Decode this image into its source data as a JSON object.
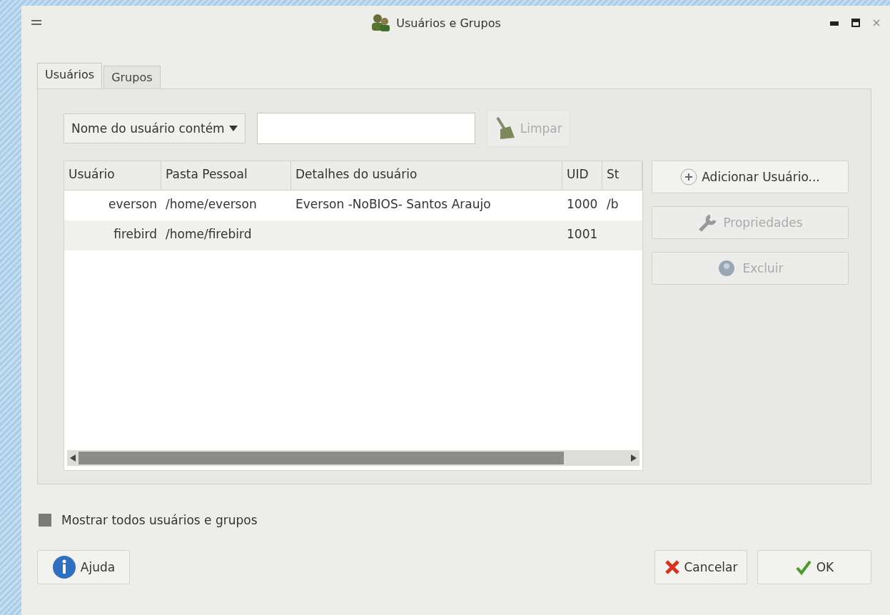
{
  "window": {
    "title": "Usuários e Grupos"
  },
  "tabs": [
    {
      "label": "Usuários",
      "selected": true
    },
    {
      "label": "Grupos",
      "selected": false
    }
  ],
  "filter": {
    "mode": "Nome do usuário contém",
    "clear_button": {
      "label": "Limpar",
      "disabled": true
    }
  },
  "table": {
    "columns": [
      "Usuário",
      "Pasta Pessoal",
      "Detalhes do usuário",
      "UID",
      "St"
    ],
    "rows": [
      {
        "cells": [
          "everson",
          "/home/everson",
          "Everson -NoBIOS- Santos Araujo",
          "1000",
          "/b"
        ],
        "selected": false
      },
      {
        "cells": [
          "firebird",
          "/home/firebird",
          "",
          "1001",
          ""
        ],
        "selected": false
      }
    ]
  },
  "side_buttons": [
    {
      "kind": "add",
      "label": "Adicionar Usuário...",
      "disabled": false
    },
    {
      "kind": "properties",
      "label": "Propriedades",
      "disabled": true
    },
    {
      "kind": "delete",
      "label": "Excluir",
      "disabled": true
    }
  ],
  "show_all": {
    "label": "Mostrar todos usuários e grupos",
    "checked": false
  },
  "buttons": [
    {
      "kind": "help",
      "label": "Ajuda"
    },
    {
      "kind": "cancel",
      "label": "Cancelar"
    },
    {
      "kind": "ok",
      "label": "OK"
    }
  ]
}
